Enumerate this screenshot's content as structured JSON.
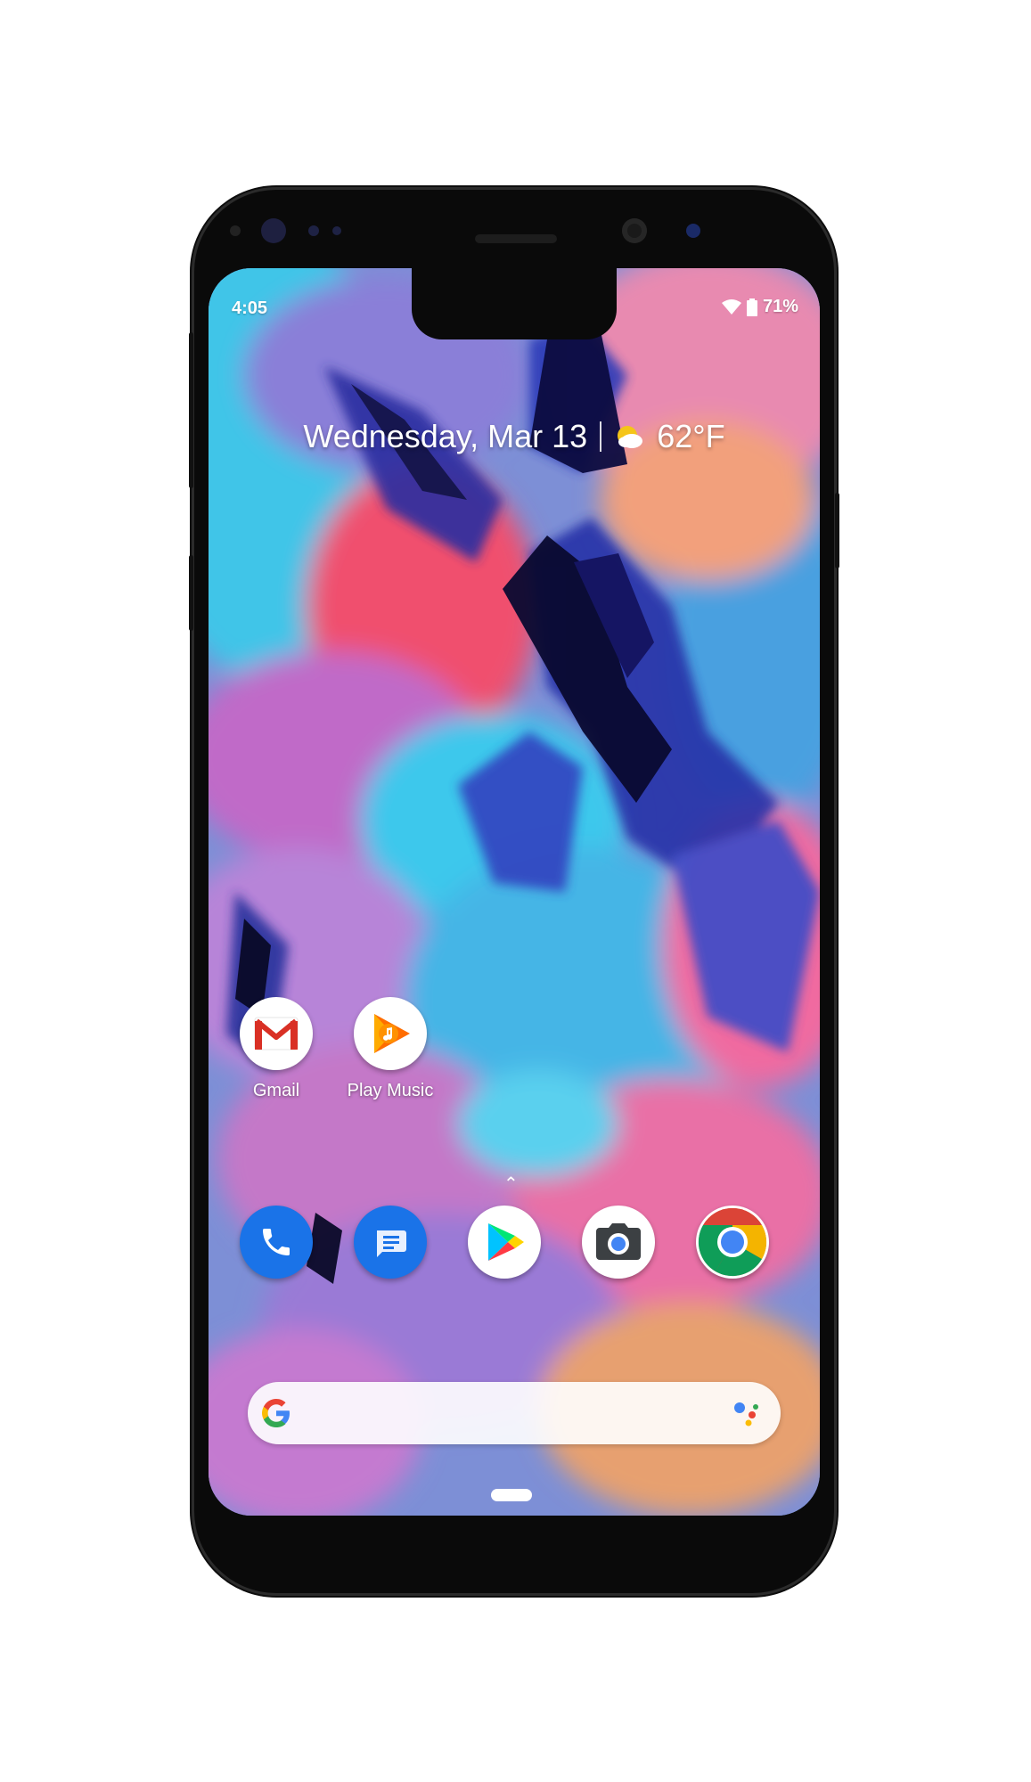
{
  "status_bar": {
    "time": "4:05",
    "battery": "71%",
    "wifi_icon": "wifi-icon",
    "battery_icon": "battery-icon"
  },
  "at_a_glance": {
    "date": "Wednesday, Mar 13",
    "weather_icon": "partly-sunny-icon",
    "temperature": "62°F"
  },
  "home_apps": [
    {
      "label": "Gmail",
      "icon": "gmail-icon"
    },
    {
      "label": "Play Music",
      "icon": "play-music-icon"
    }
  ],
  "dock": [
    {
      "icon": "phone-icon"
    },
    {
      "icon": "messages-icon"
    },
    {
      "icon": "play-store-icon"
    },
    {
      "icon": "camera-icon"
    },
    {
      "icon": "chrome-icon"
    }
  ],
  "search_bar": {
    "google_logo": "google-g-logo",
    "assistant_icon": "assistant-icon"
  },
  "colors": {
    "frame": "#0a0a0a",
    "phone_blue": "#1a73e8",
    "gmail_red": "#d93025",
    "music_orange": "#ff6d00"
  }
}
